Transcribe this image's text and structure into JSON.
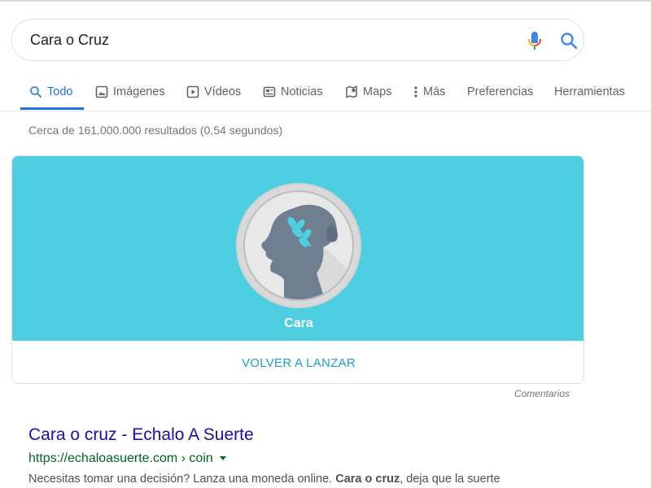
{
  "search": {
    "query": "Cara o Cruz"
  },
  "tabs": [
    {
      "label": "Todo",
      "icon": "search-icon",
      "active": true
    },
    {
      "label": "Imágenes",
      "icon": "image-icon"
    },
    {
      "label": "Vídeos",
      "icon": "video-icon"
    },
    {
      "label": "Noticias",
      "icon": "news-icon"
    },
    {
      "label": "Maps",
      "icon": "map-pin-icon"
    },
    {
      "label": "Más",
      "icon": "more-vert-icon"
    },
    {
      "label": "Preferencias"
    },
    {
      "label": "Herramientas"
    }
  ],
  "stats": "Cerca de 161.000.000 resultados (0,54 segundos)",
  "coin_flip": {
    "result": "Cara",
    "button_label": "VOLVER A LANZAR",
    "feedback": "Comentarios",
    "colors": {
      "background": "#4dcfe1",
      "button_text": "#1a9bd7"
    }
  },
  "result": {
    "title": "Cara o cruz - Echalo A Suerte",
    "url": "https://echaloasuerte.com › coin",
    "snippet_parts": [
      "Necesitas tomar una decisión? Lanza una moneda online. ",
      "Cara o cruz",
      ", deja que la suerte"
    ]
  }
}
